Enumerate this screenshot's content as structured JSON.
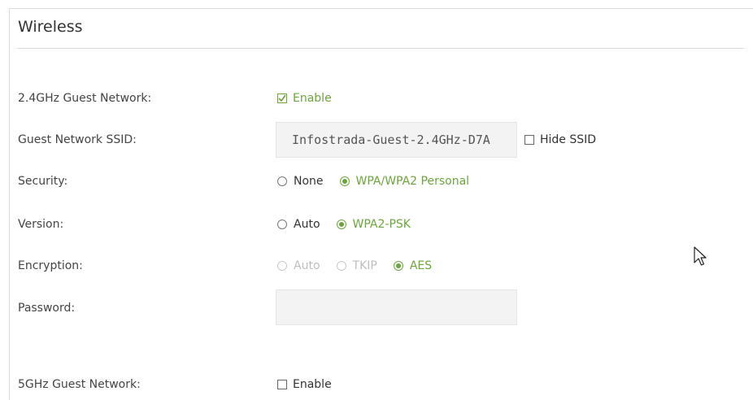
{
  "panel": {
    "title": "Wireless"
  },
  "guest24": {
    "label": "2.4GHz Guest Network:",
    "enable_label": "Enable",
    "enabled": true
  },
  "ssid": {
    "label": "Guest Network SSID:",
    "value": "Infostrada-Guest-2.4GHz-D7A",
    "hide_label": "Hide SSID",
    "hide_checked": false
  },
  "security": {
    "label": "Security:",
    "options": [
      "None",
      "WPA/WPA2 Personal"
    ],
    "selected": "WPA/WPA2 Personal"
  },
  "version": {
    "label": "Version:",
    "options": [
      "Auto",
      "WPA2-PSK"
    ],
    "selected": "WPA2-PSK"
  },
  "encryption": {
    "label": "Encryption:",
    "options": [
      "Auto",
      "TKIP",
      "AES"
    ],
    "selected": "AES",
    "disabled_options": [
      "Auto",
      "TKIP"
    ]
  },
  "password": {
    "label": "Password:",
    "value": ""
  },
  "guest5": {
    "label": "5GHz Guest Network:",
    "enable_label": "Enable",
    "enabled": false
  },
  "colors": {
    "accent": "#6ca53b",
    "field_bg": "#f3f3f3"
  },
  "icons": {
    "cursor": "mouse-pointer-icon"
  }
}
